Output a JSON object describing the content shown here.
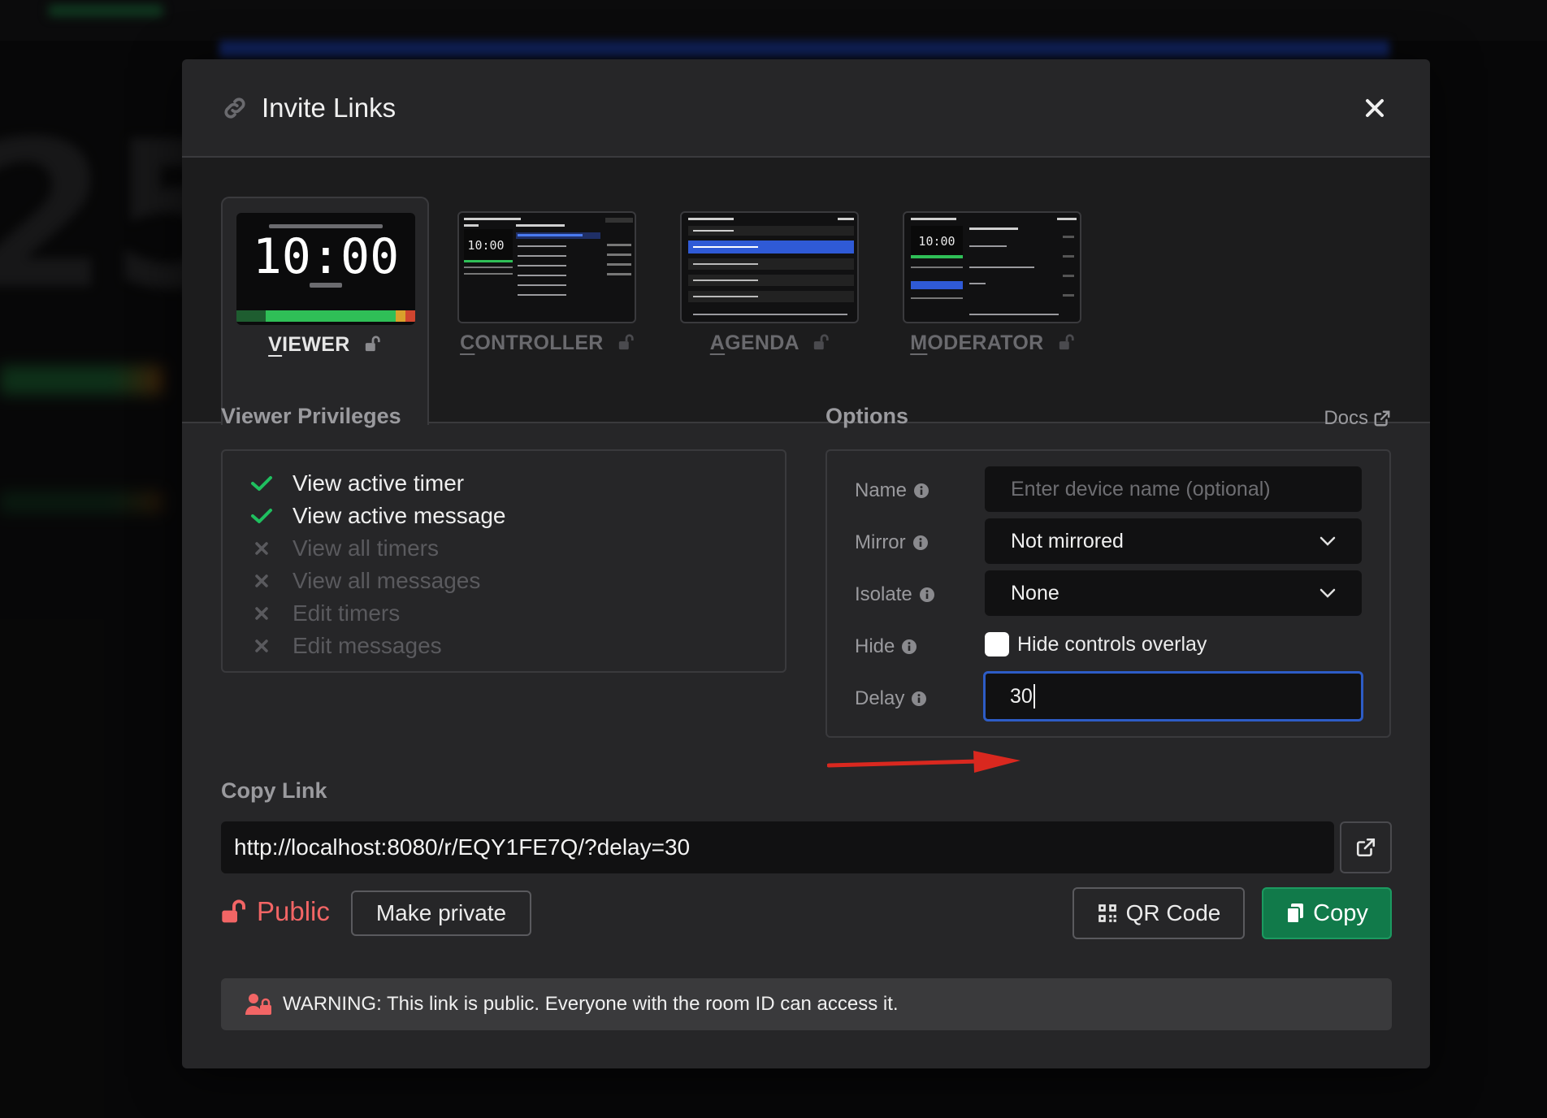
{
  "modal": {
    "title": "Invite Links"
  },
  "tabs": [
    {
      "first": "V",
      "rest": "IEWER",
      "active": true,
      "thumb_time": "10:00"
    },
    {
      "first": "C",
      "rest": "ONTROLLER",
      "active": false,
      "thumb_time": "10:00"
    },
    {
      "first": "A",
      "rest": "GENDA",
      "active": false
    },
    {
      "first": "M",
      "rest": "ODERATOR",
      "active": false,
      "thumb_time": "10:00"
    }
  ],
  "privileges": {
    "title": "Viewer Privileges",
    "items": [
      {
        "label": "View active timer",
        "enabled": true
      },
      {
        "label": "View active message",
        "enabled": true
      },
      {
        "label": "View all timers",
        "enabled": false
      },
      {
        "label": "View all messages",
        "enabled": false
      },
      {
        "label": "Edit timers",
        "enabled": false
      },
      {
        "label": "Edit messages",
        "enabled": false
      }
    ]
  },
  "options": {
    "title": "Options",
    "docs_label": "Docs",
    "name_label": "Name",
    "name_placeholder": "Enter device name (optional)",
    "mirror_label": "Mirror",
    "mirror_value": "Not mirrored",
    "isolate_label": "Isolate",
    "isolate_value": "None",
    "hide_label": "Hide",
    "hide_checkbox_label": "Hide controls overlay",
    "hide_checked": false,
    "delay_label": "Delay",
    "delay_value": "30"
  },
  "copy_link": {
    "title": "Copy Link",
    "url": "http://localhost:8080/r/EQY1FE7Q/?delay=30",
    "visibility": "Public",
    "make_private_label": "Make private",
    "qr_label": "QR Code",
    "copy_label": "Copy"
  },
  "warning": {
    "text": "WARNING: This link is public. Everyone with the room ID can access it."
  },
  "colors": {
    "accent_blue": "#2d5cc6",
    "success_green": "#1fbf5f",
    "copy_green": "#117a4a",
    "danger_red": "#f26565"
  }
}
